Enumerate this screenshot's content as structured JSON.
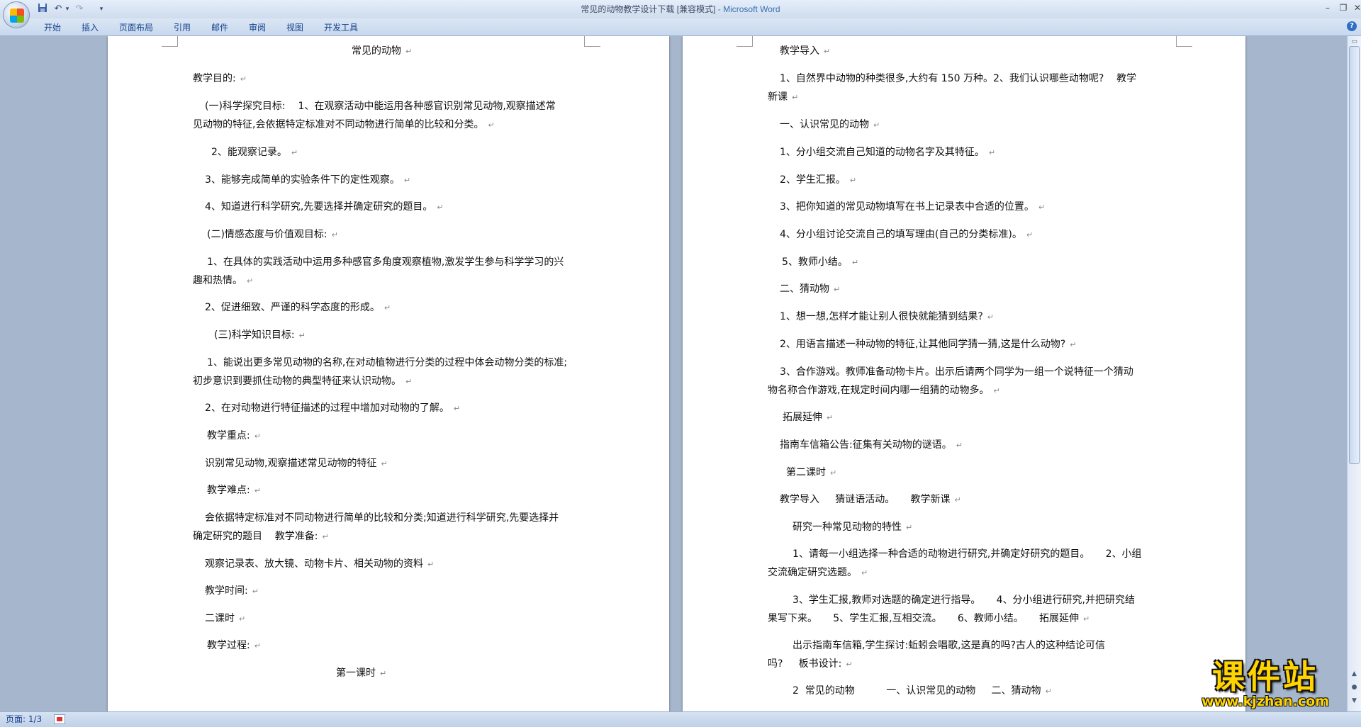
{
  "window": {
    "title_doc": "常见的动物教学设计下载 [兼容模式]",
    "title_app": " - Microsoft Word"
  },
  "quick_access": {
    "save_icon": "save-icon",
    "undo_icon": "undo-icon",
    "redo_icon": "redo-icon",
    "customize_icon": "dropdown-icon"
  },
  "ribbon_tabs": [
    "开始",
    "插入",
    "页面布局",
    "引用",
    "邮件",
    "审阅",
    "视图",
    "开发工具"
  ],
  "left_page": {
    "title": "常见的动物",
    "paragraphs": [
      "教学目的:",
      "(一)科学探究目标:    1、在观察活动中能运用各种感官识别常见动物,观察描述常",
      "见动物的特征,会依据特定标准对不同动物进行简单的比较和分类。",
      "2、能观察记录。",
      "3、能够完成简单的实验条件下的定性观察。",
      "4、知道进行科学研究,先要选择并确定研究的题目。",
      "(二)情感态度与价值观目标:",
      "1、在具体的实践活动中运用多种感官多角度观察植物,激发学生参与科学学习的兴",
      "趣和热情。",
      "2、促进细致、严谨的科学态度的形成。",
      "(三)科学知识目标:",
      "1、能说出更多常见动物的名称,在对动植物进行分类的过程中体会动物分类的标准;",
      "初步意识到要抓住动物的典型特征来认识动物。",
      "2、在对动物进行特征描述的过程中增加对动物的了解。",
      "教学重点:",
      "识别常见动物,观察描述常见动物的特征",
      "教学难点:",
      "会依据特定标准对不同动物进行简单的比较和分类;知道进行科学研究,先要选择并",
      "确定研究的题目    教学准备:",
      "观察记录表、放大镜、动物卡片、相关动物的资料",
      "教学时间:",
      "二课时",
      "教学过程:",
      "第一课时"
    ]
  },
  "right_page": {
    "paragraphs": [
      "教学导入",
      "1、自然界中动物的种类很多,大约有 150 万种。2、我们认识哪些动物呢?    教学",
      "新课",
      "一、认识常见的动物",
      "1、分小组交流自己知道的动物名字及其特征。",
      "2、学生汇报。",
      "3、把你知道的常见动物填写在书上记录表中合适的位置。",
      "4、分小组讨论交流自己的填写理由(自己的分类标准)。",
      "5、教师小结。",
      "二、猜动物",
      "1、想一想,怎样才能让别人很快就能猜到结果?",
      "2、用语言描述一种动物的特征,让其他同学猜一猜,这是什么动物?",
      "3、合作游戏。教师准备动物卡片。出示后请两个同学为一组一个说特征一个猜动",
      "物名称合作游戏,在规定时间内哪一组猜的动物多。",
      "拓展延伸",
      "指南车信箱公告:征集有关动物的谜语。",
      "第二课时",
      "教学导入     猜谜语活动。     教学新课",
      "研究一种常见动物的特性",
      "1、请每一小组选择一种合适的动物进行研究,并确定好研究的题目。     2、小组",
      "交流确定研究选题。",
      "3、学生汇报,教师对选题的确定进行指导。     4、分小组进行研究,并把研究结",
      "果写下来。     5、学生汇报,互相交流。     6、教师小结。     拓展延伸",
      "出示指南车信箱,学生探讨:蚯蚓会唱歌,这是真的吗?古人的这种结论可信",
      "吗?     板书设计:",
      "2  常见的动物          一、认识常见的动物     二、猜动物"
    ]
  },
  "status": {
    "page": "页面: 1/3"
  },
  "watermark": {
    "cn": "课件站",
    "url": "www.kjzhan.com"
  }
}
